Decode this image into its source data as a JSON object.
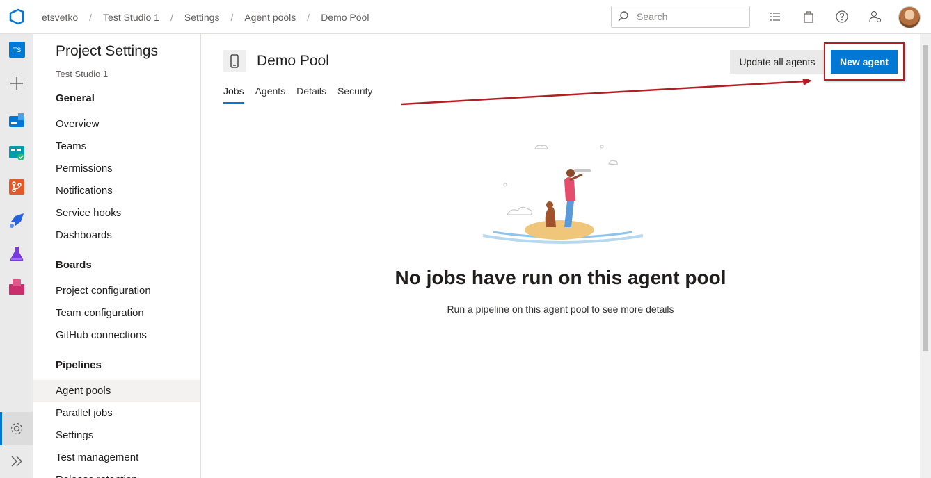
{
  "breadcrumb": [
    "etsvetko",
    "Test Studio 1",
    "Settings",
    "Agent pools",
    "Demo Pool"
  ],
  "search": {
    "placeholder": "Search"
  },
  "rail": {
    "project_badge": "TS"
  },
  "panel": {
    "title": "Project Settings",
    "subtitle": "Test Studio 1",
    "groups": [
      {
        "label": "General",
        "items": [
          "Overview",
          "Teams",
          "Permissions",
          "Notifications",
          "Service hooks",
          "Dashboards"
        ]
      },
      {
        "label": "Boards",
        "items": [
          "Project configuration",
          "Team configuration",
          "GitHub connections"
        ]
      },
      {
        "label": "Pipelines",
        "items": [
          "Agent pools",
          "Parallel jobs",
          "Settings",
          "Test management",
          "Release retention"
        ]
      }
    ],
    "selected": "Agent pools"
  },
  "main": {
    "title": "Demo Pool",
    "update_button": "Update all agents",
    "new_button": "New agent",
    "tabs": [
      "Jobs",
      "Agents",
      "Details",
      "Security"
    ],
    "active_tab": "Jobs",
    "empty_title": "No jobs have run on this agent pool",
    "empty_subtitle": "Run a pipeline on this agent pool to see more details"
  },
  "colors": {
    "accent": "#0078d4",
    "annotation": "#b11f24"
  }
}
